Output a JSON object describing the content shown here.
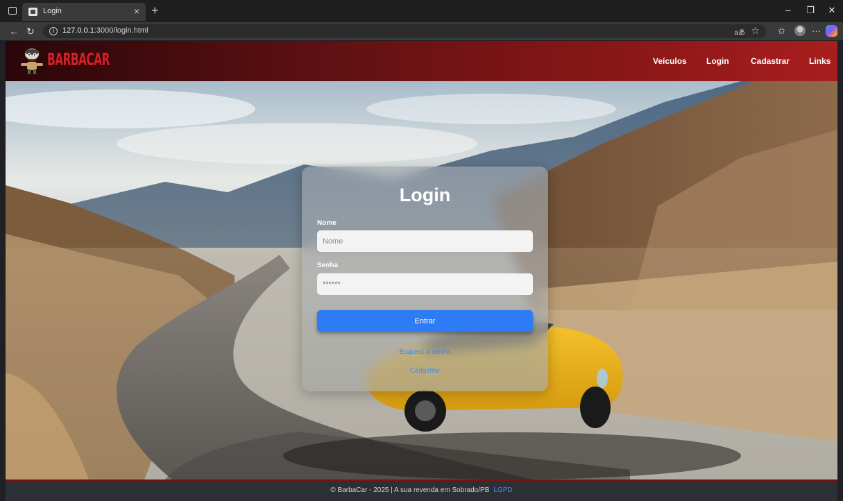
{
  "browser": {
    "tab_title": "Login",
    "url_host": "127.0.0.1",
    "url_rest": ":3000/login.html",
    "reader_label": "aあ"
  },
  "site": {
    "logo_text": "BARBACAR",
    "nav": [
      "Veículos",
      "Login",
      "Cadastrar",
      "Links"
    ]
  },
  "login": {
    "title": "Login",
    "name_label": "Nome",
    "name_placeholder": "Nome",
    "password_label": "Senha",
    "password_value": "******",
    "submit_label": "Entrar",
    "forgot_link": "Esqueci a senha",
    "register_link": "Cadastrar"
  },
  "footer": {
    "copyright": "© BarbaCar - 2025 | A sua revenda em Sobrado/PB",
    "lgpd": "LGPD"
  },
  "colors": {
    "navbar_dark": "#2a0608",
    "navbar_red": "#a81e1e",
    "button_blue": "#2d7cf6",
    "link_blue": "#3d8cf5",
    "footer_bg": "#2c2f33"
  }
}
